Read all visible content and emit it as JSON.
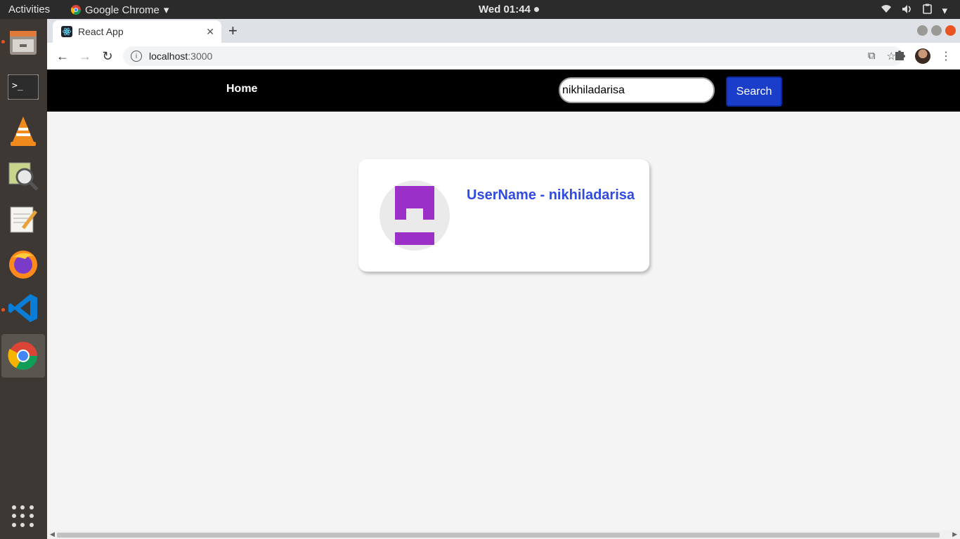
{
  "system_bar": {
    "activities": "Activities",
    "app_name": "Google Chrome",
    "clock": "Wed 01:44"
  },
  "browser": {
    "tab_title": "React App",
    "url_host": "localhost",
    "url_port": ":3000"
  },
  "app": {
    "nav_home": "Home",
    "search_value": "nikhiladarisa",
    "search_button": "Search",
    "card_username": "UserName - nikhiladarisa"
  },
  "colors": {
    "nav_bg": "#000000",
    "search_button": "#1a3ec9",
    "username_text": "#2f4be0",
    "avatar_logo": "#9b30c8"
  }
}
